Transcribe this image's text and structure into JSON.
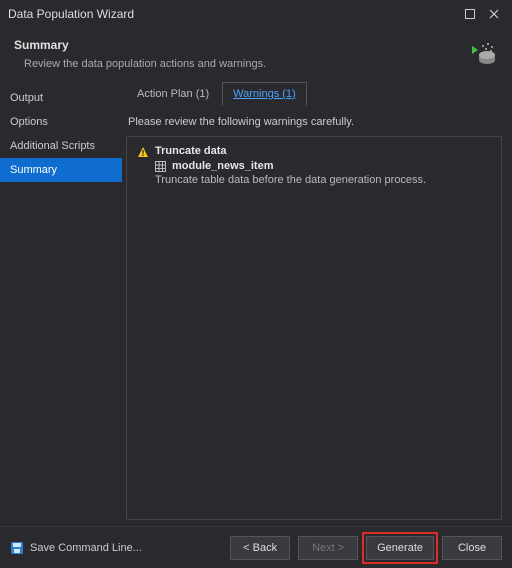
{
  "window": {
    "title": "Data Population Wizard"
  },
  "header": {
    "title": "Summary",
    "description": "Review the data population actions and warnings."
  },
  "sidebar": {
    "items": [
      {
        "label": "Output"
      },
      {
        "label": "Options"
      },
      {
        "label": "Additional Scripts"
      },
      {
        "label": "Summary"
      }
    ],
    "activeIndex": 3
  },
  "tabs": {
    "action_plan": "Action Plan (1)",
    "warnings": "Warnings (1)",
    "active": "warnings"
  },
  "content": {
    "instruction": "Please review the following warnings carefully.",
    "warning_title": "Truncate data",
    "object_name": "module_news_item",
    "warning_desc": "Truncate table data before the data generation process."
  },
  "footer": {
    "save_cmd": "Save Command Line...",
    "back": "< Back",
    "next": "Next >",
    "generate": "Generate",
    "close": "Close"
  }
}
